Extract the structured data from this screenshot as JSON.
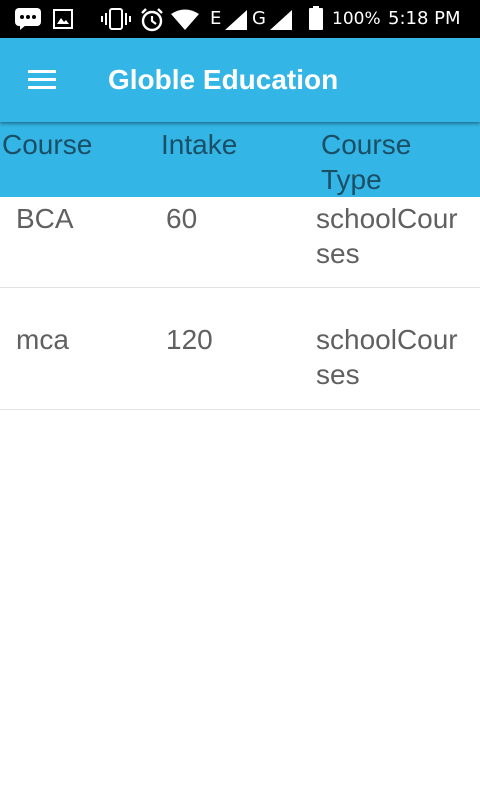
{
  "status_bar": {
    "battery_percent": "100%",
    "time": "5:18 PM",
    "network_e": "E",
    "network_g": "G",
    "icons": [
      "message-icon",
      "image-icon",
      "vibrate-icon",
      "alarm-icon",
      "wifi-icon",
      "signal-icon",
      "signal-icon",
      "battery-icon"
    ]
  },
  "toolbar": {
    "title": "Globle Education",
    "menu_icon": "hamburger-menu-icon",
    "background": "#33b5e5"
  },
  "table": {
    "headers": [
      "Course",
      "Intake",
      "Course Type"
    ],
    "rows": [
      {
        "course": "BCA",
        "intake": "60",
        "type": "schoolCourses"
      },
      {
        "course": "mca",
        "intake": "120",
        "type": "schoolCourses"
      }
    ]
  }
}
